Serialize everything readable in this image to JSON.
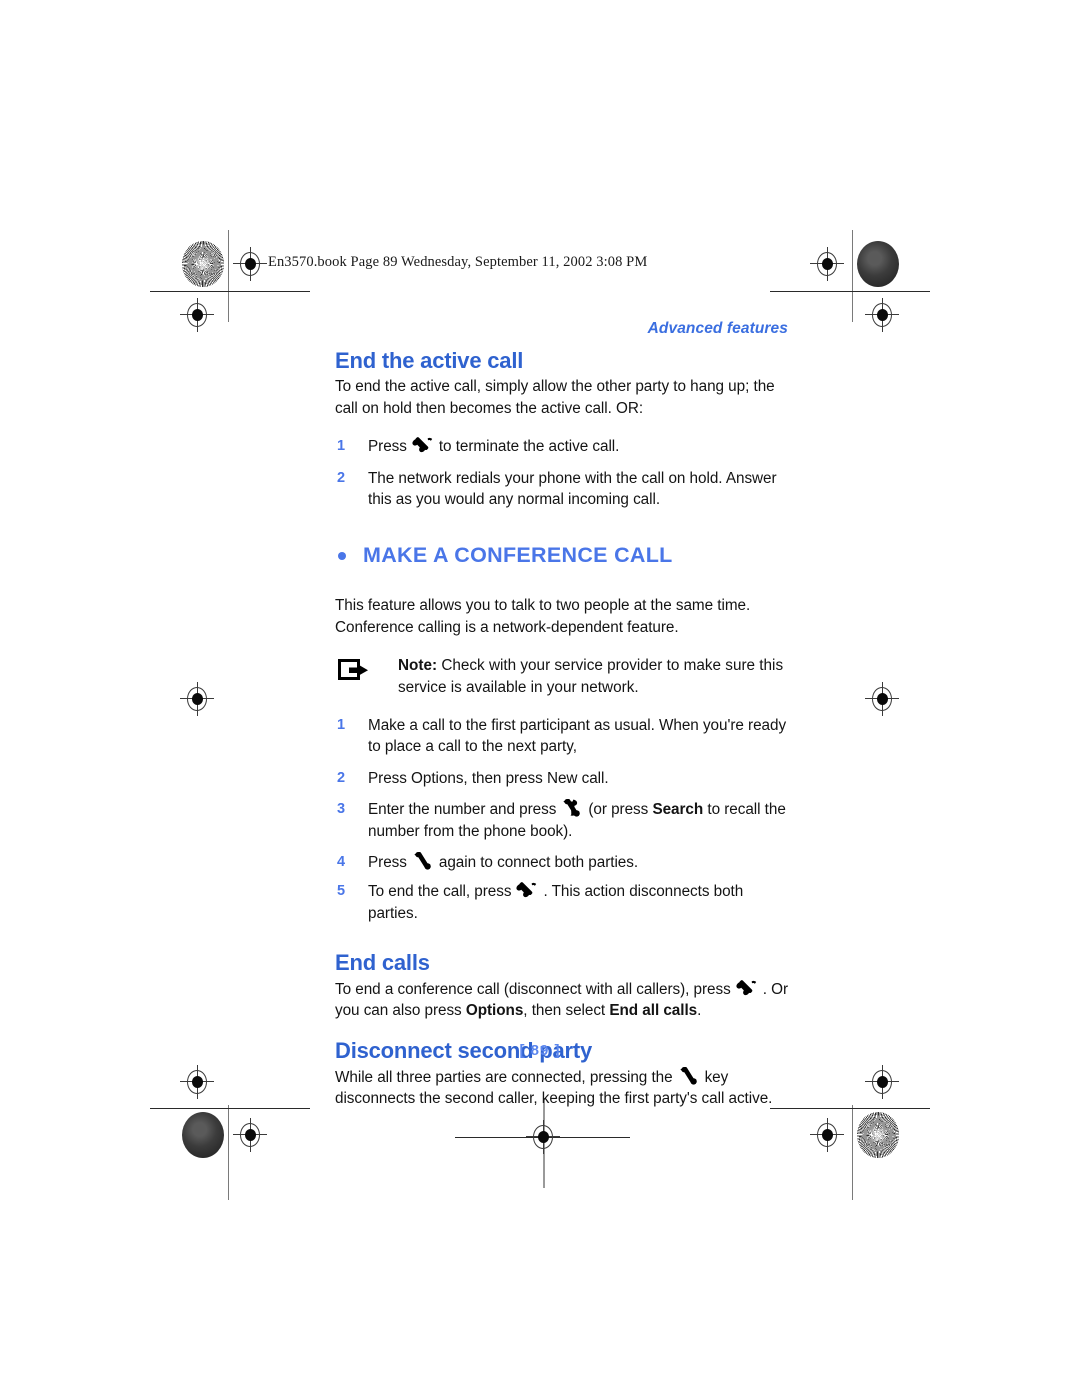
{
  "document": {
    "file_header": "En3570.book  Page 89  Wednesday, September 11, 2002  3:08 PM",
    "running_head": "Advanced features",
    "folio": "[ 89 ]"
  },
  "colors": {
    "heading_sub": "#2f62cf",
    "heading_section": "#4a76e8",
    "running_head": "#3a6ee0",
    "step_number": "#4a76e8",
    "folio": "#5b86ee",
    "body_text": "#141414"
  },
  "icons": {
    "end_call_key": "end-call-handset-icon",
    "send_call_key": "send-call-handset-icon",
    "note": "note-arrow-icon"
  },
  "sections": {
    "end_active_call": {
      "heading": "End the active call",
      "intro": "To end the active call, simply allow the other party to hang up; the call on hold then becomes the active call. OR:",
      "steps": [
        {
          "num": "1",
          "text_before": "Press",
          "icon": "end-call-handset-icon",
          "text_after": "to terminate the active call."
        },
        {
          "num": "2",
          "text_before": "The network redials your phone with the call on hold. Answer this as you would any normal incoming call.",
          "icon": null,
          "text_after": ""
        }
      ]
    },
    "make_conference_call": {
      "heading": "MAKE A CONFERENCE CALL",
      "intro": "This feature allows you to talk to two people at the same time. Conference calling is a network-dependent feature.",
      "note_label": "Note:",
      "note_text": " Check with your service provider to make sure this service is available in your network.",
      "steps": [
        {
          "num": "1",
          "text_before": "Make a call to the first participant as usual. When you're ready to place a call to the next party,",
          "icon": null,
          "text_after": ""
        },
        {
          "num": "2",
          "text_before": "Press Options, then press New call.",
          "icon": null,
          "text_after": ""
        },
        {
          "num": "3",
          "text_before": "Enter the number and press",
          "icon": "send-call-handset-icon",
          "text_after": "(or press ",
          "bold_term": "Search",
          "text_tail": " to recall the number from the phone book)."
        },
        {
          "num": "4",
          "text_before": "Press",
          "icon": "send-call-handset-icon",
          "text_after": "again to connect both parties."
        },
        {
          "num": "5",
          "text_before": "To end the call, press",
          "icon": "end-call-handset-icon",
          "text_after": ". This action disconnects both parties."
        }
      ]
    },
    "end_calls": {
      "heading": "End calls",
      "text_before": "To end a conference call (disconnect with all callers), press",
      "icon": "end-call-handset-icon",
      "text_mid": ". Or you can also press ",
      "bold_one": "Options",
      "text_mid2": ", then select ",
      "bold_two": "End all calls",
      "text_tail": "."
    },
    "disconnect_second_party": {
      "heading": "Disconnect second party",
      "text_before": "While all three parties are connected, pressing the",
      "icon": "send-call-handset-icon",
      "text_after": "key disconnects the second caller, keeping the first party's call active."
    }
  }
}
